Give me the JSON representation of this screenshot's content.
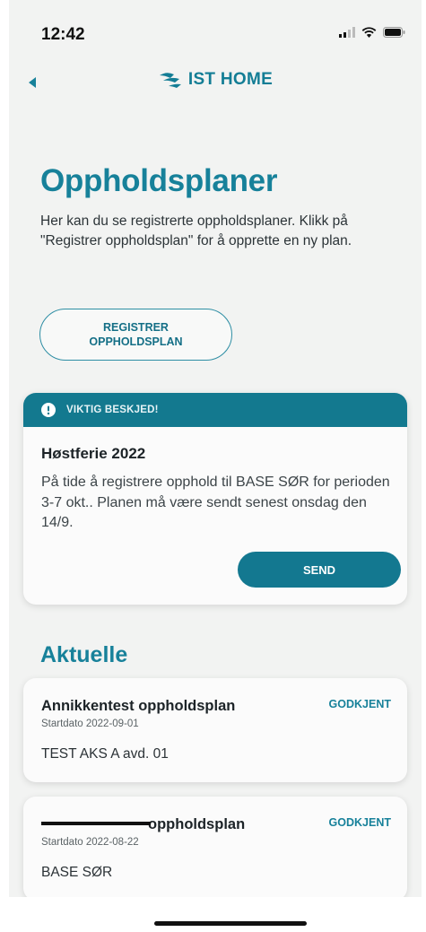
{
  "status_bar": {
    "time": "12:42"
  },
  "nav": {
    "brand": "IST HOME"
  },
  "page": {
    "title": "Oppholdsplaner",
    "intro": "Her kan du se registrerte oppholdsplaner. Klikk på \"Registrer oppholdsplan\" for å opprette en ny plan.",
    "register_button_line1": "REGISTRER",
    "register_button_line2": "OPPHOLDSPLAN"
  },
  "notice": {
    "label": "VIKTIG BESKJED!",
    "title": "Høstferie 2022",
    "body": "På tide å registrere opphold til BASE SØR for perioden 3-7 okt.. Planen må være sendt senest onsdag den 14/9.",
    "send_label": "SEND"
  },
  "section": {
    "heading": "Aktuelle"
  },
  "plans": [
    {
      "name": "Annikkentest oppholdsplan",
      "status": "GODKJENT",
      "start_date": "Startdato 2022-09-01",
      "location": "TEST AKS A avd. 01"
    },
    {
      "name": "oppholdsplan",
      "status": "GODKJENT",
      "start_date": "Startdato 2022-08-22",
      "location": "BASE SØR"
    }
  ],
  "colors": {
    "accent": "#17819a",
    "banner": "#13798f",
    "background": "#f2f3f2"
  },
  "icons": [
    "signal-icon",
    "wifi-icon",
    "battery-icon",
    "back-arrow-icon",
    "brand-logo-icon",
    "exclamation-icon"
  ]
}
